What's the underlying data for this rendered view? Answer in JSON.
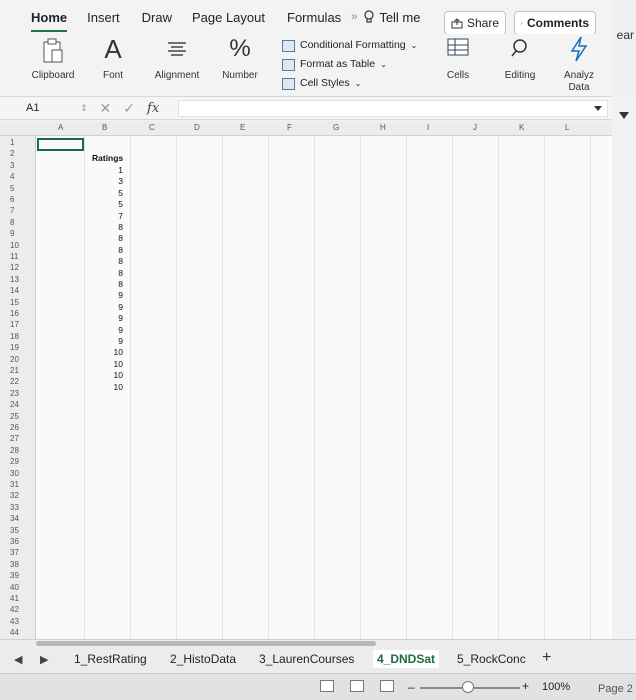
{
  "ribbon_tabs": [
    "Home",
    "Insert",
    "Draw",
    "Page Layout",
    "Formulas"
  ],
  "more_glyph": "»",
  "tell_me": "Tell me",
  "share_label": "Share",
  "comments_label": "Comments",
  "edge_text": "ear",
  "groups": {
    "clipboard": "Clipboard",
    "font": "Font",
    "alignment": "Alignment",
    "number": "Number",
    "cells": "Cells",
    "editing": "Editing",
    "analyze_line1": "Analyz",
    "analyze_line2": "Data"
  },
  "styles": {
    "conditional": "Conditional Formatting",
    "format_table": "Format as Table",
    "cell_styles": "Cell Styles"
  },
  "name_box": "A1",
  "fx_label": "fx",
  "columns": [
    "A",
    "B",
    "C",
    "D",
    "E",
    "F",
    "G",
    "H",
    "I",
    "J",
    "K",
    "L"
  ],
  "rows": [
    "1",
    "2",
    "3",
    "4",
    "5",
    "6",
    "7",
    "8",
    "9",
    "10",
    "11",
    "12",
    "13",
    "14",
    "15",
    "16",
    "17",
    "18",
    "19",
    "20",
    "21",
    "22",
    "23",
    "24",
    "25",
    "26",
    "27",
    "28",
    "29",
    "30",
    "31",
    "32",
    "33",
    "34",
    "35",
    "36",
    "37",
    "38",
    "39",
    "40",
    "41",
    "42",
    "43",
    "44"
  ],
  "ratings_header": "Ratings",
  "ratings": [
    "1",
    "3",
    "5",
    "5",
    "7",
    "8",
    "8",
    "8",
    "8",
    "8",
    "8",
    "9",
    "9",
    "9",
    "9",
    "9",
    "10",
    "10",
    "10",
    "10"
  ],
  "sheet_tabs": [
    "1_RestRating",
    "2_HistoData",
    "3_LaurenCourses",
    "4_DNDSat",
    "5_RockConc"
  ],
  "active_sheet": "4_DNDSat",
  "zoom": "100%",
  "page_label": "Page 2"
}
